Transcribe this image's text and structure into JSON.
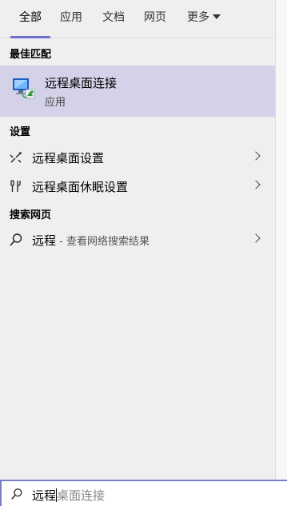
{
  "tabs": [
    {
      "label": "全部",
      "active": true
    },
    {
      "label": "应用",
      "active": false
    },
    {
      "label": "文档",
      "active": false
    },
    {
      "label": "网页",
      "active": false
    },
    {
      "label": "更多",
      "active": false
    }
  ],
  "sections": {
    "best_match": "最佳匹配",
    "settings": "设置",
    "web": "搜索网页"
  },
  "best_match": {
    "title": "远程桌面连接",
    "subtitle": "应用",
    "icon": "remote-desktop-icon"
  },
  "settings_items": [
    {
      "label": "远程桌面设置",
      "icon": "remote-settings-icon"
    },
    {
      "label": "远程桌面休眠设置",
      "icon": "sleep-settings-icon"
    }
  ],
  "web_item": {
    "query": "远程",
    "suffix": " - 查看网络搜索结果",
    "icon": "search-icon"
  },
  "search": {
    "typed": "远程",
    "suggestion": "桌面连接"
  },
  "colors": {
    "accent": "#6f6fcf",
    "selection": "#d3d2e8",
    "background": "#efefef"
  }
}
